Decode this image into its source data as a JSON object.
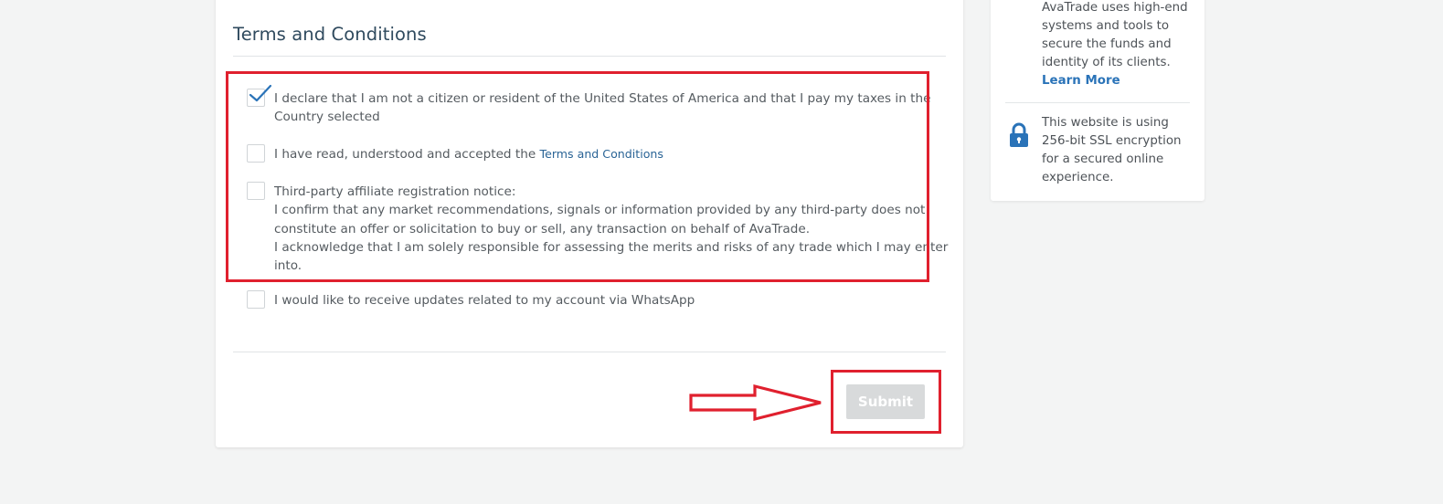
{
  "terms_section": {
    "title": "Terms and Conditions",
    "items": [
      {
        "checked": true,
        "lines": [
          "I declare that I am not a citizen or resident of the United States of America and that I pay my taxes in the",
          "Country selected"
        ]
      },
      {
        "checked": false,
        "prefix": "I have read, understood and accepted the ",
        "link": "Terms and Conditions"
      },
      {
        "checked": false,
        "lines": [
          "Third-party affiliate registration notice:",
          "I confirm that any market recommendations, signals or information provided by any third-party does not",
          "constitute an offer or solicitation to buy or sell, any transaction on behalf of AvaTrade.",
          "I acknowledge that I am solely responsible for assessing the merits and risks of any trade which I may enter",
          "into."
        ]
      },
      {
        "checked": false,
        "lines": [
          "I would like to receive updates related to my account via WhatsApp"
        ]
      }
    ],
    "submit_label": "Submit"
  },
  "sidebar": {
    "security_lines": [
      "AvaTrade uses high-end",
      "systems and tools to",
      "secure the funds and",
      "identity of its clients."
    ],
    "learn_more": "Learn More",
    "ssl_lines": [
      "This website is using",
      "256-bit SSL encryption",
      "for a secured online",
      "experience."
    ]
  },
  "colors": {
    "background": "#f3f4f4",
    "title": "#2f4a5e",
    "link": "#2a6496",
    "learn_more": "#2a73b8",
    "check": "#2a73b8",
    "annotation_red": "#e0202e",
    "submit_disabled": "#d8dadb"
  },
  "icons": {
    "checkmark": "checkmark-icon",
    "lock": "lock-icon",
    "arrow": "arrow-right-annotation"
  }
}
